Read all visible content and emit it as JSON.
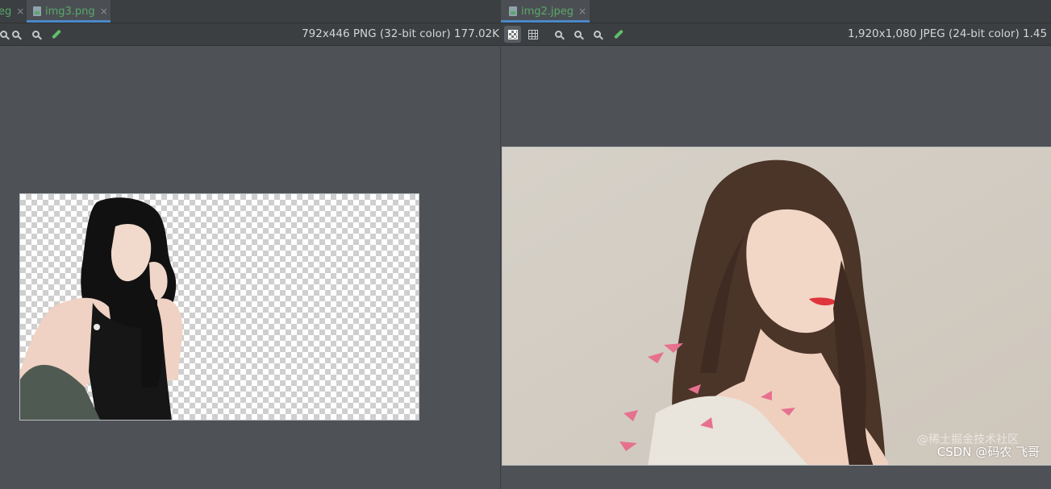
{
  "left_pane": {
    "tabs": [
      {
        "label": "eg",
        "active": false
      },
      {
        "label": "img3.png",
        "active": true
      }
    ],
    "image_info": "792x446 PNG (32-bit color) 177.02K"
  },
  "right_pane": {
    "tabs": [
      {
        "label": "img2.jpeg",
        "active": true
      }
    ],
    "image_info": "1,920x1,080 JPEG (24-bit color) 1.45"
  },
  "watermark": {
    "main": "CSDN @码农 飞哥",
    "ghost": "@稀土掘金技术社区"
  },
  "icons": {
    "close": "×",
    "zoom_in": "zoom-in-icon",
    "zoom_out": "zoom-out-icon",
    "actual_size": "actual-size-icon",
    "color_picker": "color-picker-icon",
    "chessboard": "chessboard-icon",
    "grid": "grid-icon"
  },
  "colors": {
    "tab_text": "#59a869",
    "tab_underline": "#4a88c7",
    "background": "#4e5257",
    "toolbar": "#3c3f41"
  }
}
